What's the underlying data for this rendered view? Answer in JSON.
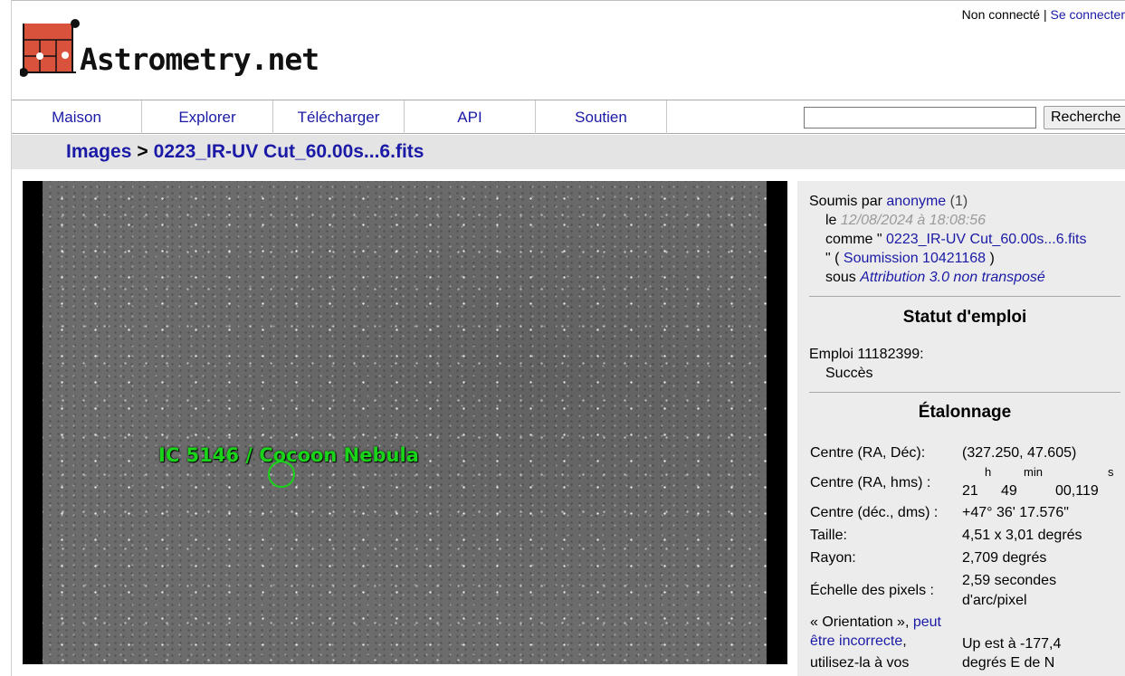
{
  "header": {
    "logo_text": "Astrometry.net",
    "login_status": "Non connecté",
    "login_separator": "|",
    "login_link": "Se connecter"
  },
  "nav": {
    "items": [
      {
        "label": "Maison"
      },
      {
        "label": "Explorer"
      },
      {
        "label": "Télécharger"
      },
      {
        "label": "API"
      },
      {
        "label": "Soutien"
      }
    ],
    "search_value": "",
    "search_button": "Recherche"
  },
  "breadcrumb": {
    "root": "Images",
    "separator": ">",
    "current": "0223_IR-UV Cut_60.00s...6.fits"
  },
  "image": {
    "annotation": "IC 5146 / Cocoon Nebula",
    "colors": {
      "annotation": "#19d419",
      "background": "#6c6c6c"
    }
  },
  "submission": {
    "submitted_by_label": "Soumis par",
    "user": "anonyme",
    "user_count": "(1)",
    "on_label": "le",
    "date": "12/08/2024 à 18:08:56",
    "as_label": "comme \"",
    "filename": "0223_IR-UV Cut_60.00s...6.fits",
    "submission_prefix": "\" (",
    "submission_link": "Soumission 10421168",
    "submission_suffix": ")",
    "license_label": "sous",
    "license": "Attribution 3.0 non transposé"
  },
  "job": {
    "title": "Statut d'emploi",
    "job_label": "Emploi 11182399:",
    "status": "Succès"
  },
  "calibration": {
    "title": "Étalonnage",
    "rows": [
      {
        "label": "Centre (RA, Déc):",
        "value": "(327.250, 47.605)"
      },
      {
        "label": "Centre (RA, hms) :",
        "h": "21",
        "h_unit": "h",
        "m": "49",
        "m_unit": "min",
        "s": "00,119",
        "s_unit": "s"
      },
      {
        "label": "Centre (déc., dms) :",
        "value": "+47° 36' 17.576\""
      },
      {
        "label": "Taille:",
        "value": "4,51 x 3,01 degrés"
      },
      {
        "label": "Rayon:",
        "value": "2,709 degrés"
      },
      {
        "label": "Échelle des pixels :",
        "value_line1": "2,59 secondes",
        "value_line2": "d'arc/pixel"
      }
    ],
    "orientation": {
      "label_prefix": "« Orientation »,",
      "link_line1": "peut",
      "link_line2": "être incorrecte",
      "label_suffix": ",",
      "label_line3": "utilisez-la à vos",
      "value_line1": "Up est à -177,4",
      "value_line2": "degrés E de N"
    }
  }
}
